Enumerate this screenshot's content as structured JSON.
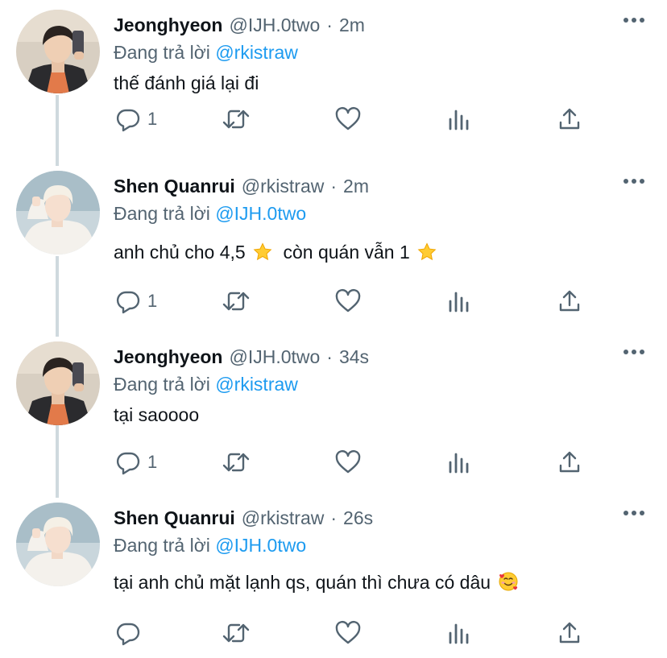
{
  "tweets": [
    {
      "name": "Jeonghyeon",
      "handle": "@IJH.0two",
      "separator": "·",
      "time": "2m",
      "reply_prefix": "Đang trả lời",
      "reply_to": "@rkistraw",
      "text_parts": [
        "thế đánh giá lại đi"
      ],
      "reply_count": "1",
      "avatar_icon": "avatar-jeonghyeon"
    },
    {
      "name": "Shen Quanrui",
      "handle": "@rkistraw",
      "separator": "·",
      "time": "2m",
      "reply_prefix": "Đang trả lời",
      "reply_to": "@IJH.0two",
      "text_parts": [
        "anh chủ cho 4,5",
        "còn quán vẫn 1"
      ],
      "emojis": [
        "star-emoji",
        "star-emoji"
      ],
      "reply_count": "1",
      "avatar_icon": "avatar-shen-quanrui"
    },
    {
      "name": "Jeonghyeon",
      "handle": "@IJH.0two",
      "separator": "·",
      "time": "34s",
      "reply_prefix": "Đang trả lời",
      "reply_to": "@rkistraw",
      "text_parts": [
        "tại saoooo"
      ],
      "reply_count": "1",
      "avatar_icon": "avatar-jeonghyeon"
    },
    {
      "name": "Shen Quanrui",
      "handle": "@rkistraw",
      "separator": "·",
      "time": "26s",
      "reply_prefix": "Đang trả lời",
      "reply_to": "@IJH.0two",
      "text_parts": [
        "tại anh chủ mặt lạnh qs, quán thì chưa có dâu"
      ],
      "emojis": [
        "smiling-face-with-hearts-emoji"
      ],
      "reply_count": "",
      "avatar_icon": "avatar-shen-quanrui"
    }
  ],
  "action_icons": [
    "reply-icon",
    "retweet-icon",
    "like-icon",
    "analytics-icon",
    "share-icon"
  ],
  "colors": {
    "text": "#0f1419",
    "secondary": "#536471",
    "mention": "#1d9bf0",
    "thread_line": "#cfd9de"
  }
}
